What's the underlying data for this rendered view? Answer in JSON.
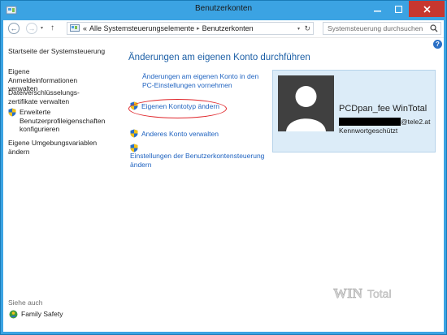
{
  "window": {
    "title": "Benutzerkonten"
  },
  "address": {
    "root_marker": "«",
    "crumbs": [
      "Alle Systemsteuerungselemente",
      "Benutzerkonten"
    ],
    "search_placeholder": "Systemsteuerung durchsuchen"
  },
  "sidebar": {
    "items": [
      "Startseite der Systemsteuerung",
      "Eigene Anmeldeinformationen verwalten",
      "Dateiverschlüsselungs-zertifikate verwalten",
      "Erweiterte Benutzerprofileigenschaften konfigurieren",
      "Eigene Umgebungsvariablen ändern"
    ],
    "see_also_label": "Siehe auch",
    "see_also_items": [
      "Family Safety"
    ]
  },
  "main": {
    "heading": "Änderungen am eigenen Konto durchführen",
    "pc_settings_link": "Änderungen am eigenen Konto in den PC-Einstellungen vornehmen",
    "change_type_link": "Eigenen Kontotyp ändern",
    "manage_other_link": "Anderes Konto verwalten",
    "uac_link": "Einstellungen der Benutzerkontensteuerung ändern"
  },
  "account": {
    "name": "PCDpan_fee WinTotal",
    "email_tail": "@tele2.at",
    "status": "Kennwortgeschützt"
  },
  "watermark": "WIN Total",
  "colors": {
    "accent": "#3ba3e3",
    "link": "#1f63c0",
    "heading": "#1c5fa6",
    "highlight": "#e0262b",
    "card": "#dcecf8"
  }
}
